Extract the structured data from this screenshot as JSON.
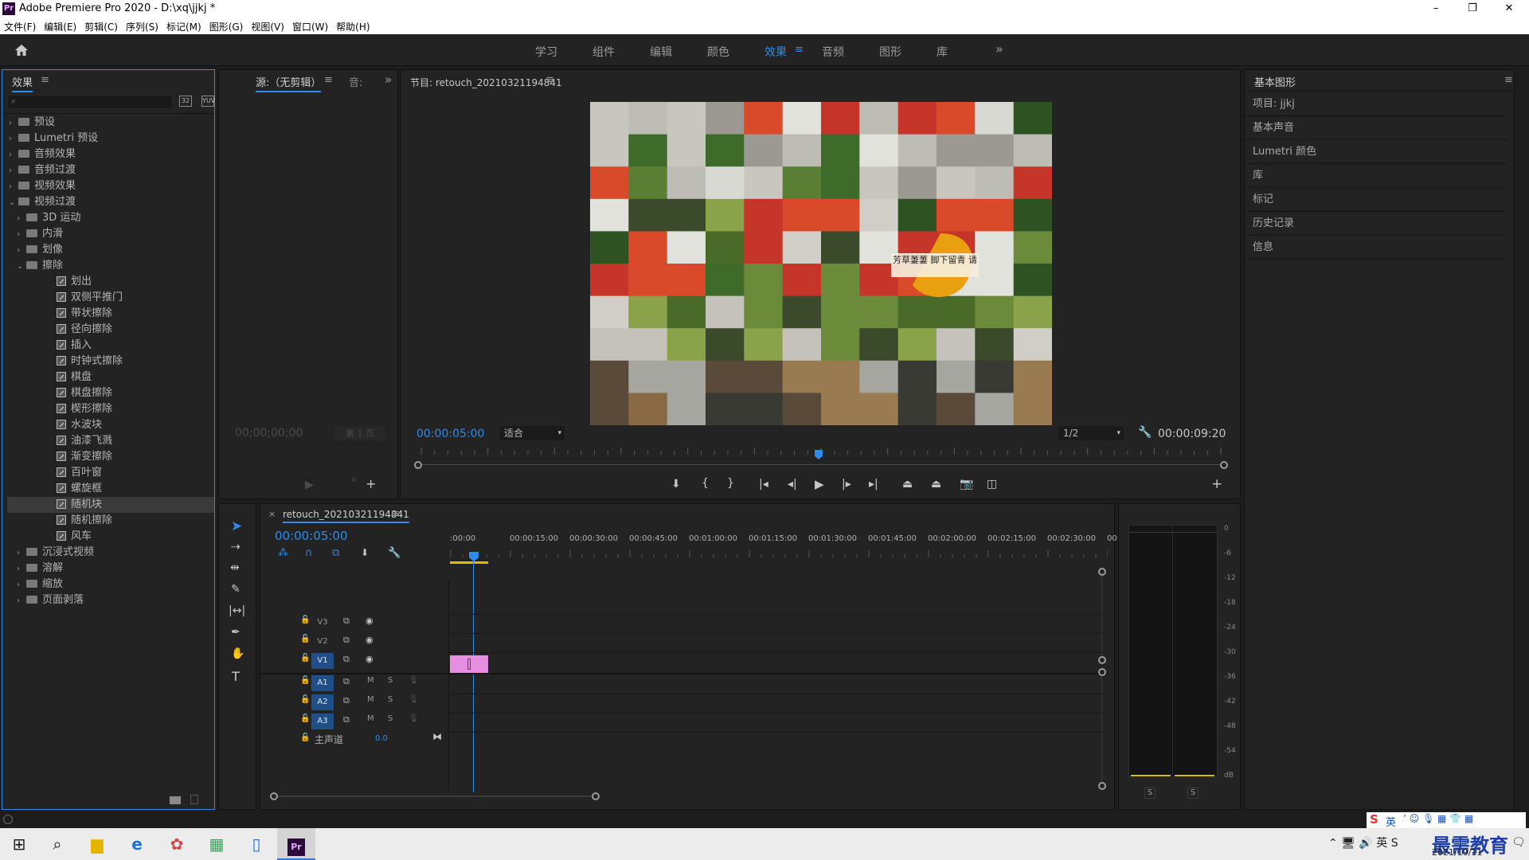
{
  "app": {
    "title": "Adobe Premiere Pro 2020 - D:\\xq\\jjkj *",
    "logo_text": "Pr"
  },
  "window_controls": {
    "minimize": "–",
    "restore": "❐",
    "close": "✕"
  },
  "menu": [
    "文件(F)",
    "编辑(E)",
    "剪辑(C)",
    "序列(S)",
    "标记(M)",
    "图形(G)",
    "视图(V)",
    "窗口(W)",
    "帮助(H)"
  ],
  "workspaces": {
    "tabs": [
      "学习",
      "组件",
      "编辑",
      "颜色",
      "效果",
      "音频",
      "图形",
      "库"
    ],
    "active": "效果",
    "overflow": "»"
  },
  "effects_panel": {
    "title": "效果",
    "tree": [
      {
        "label": "预设",
        "level": 0,
        "kind": "folder",
        "state": "collapsed"
      },
      {
        "label": "Lumetri 预设",
        "level": 0,
        "kind": "folder",
        "state": "collapsed"
      },
      {
        "label": "音频效果",
        "level": 0,
        "kind": "folder",
        "state": "collapsed"
      },
      {
        "label": "音频过渡",
        "level": 0,
        "kind": "folder",
        "state": "collapsed"
      },
      {
        "label": "视频效果",
        "level": 0,
        "kind": "folder",
        "state": "collapsed"
      },
      {
        "label": "视频过渡",
        "level": 0,
        "kind": "folder",
        "state": "expanded"
      },
      {
        "label": "3D 运动",
        "level": 1,
        "kind": "folder",
        "state": "collapsed"
      },
      {
        "label": "内滑",
        "level": 1,
        "kind": "folder",
        "state": "collapsed"
      },
      {
        "label": "划像",
        "level": 1,
        "kind": "folder",
        "state": "collapsed"
      },
      {
        "label": "擦除",
        "level": 1,
        "kind": "folder",
        "state": "expanded"
      },
      {
        "label": "划出",
        "level": 2,
        "kind": "effect"
      },
      {
        "label": "双侧平推门",
        "level": 2,
        "kind": "effect"
      },
      {
        "label": "带状擦除",
        "level": 2,
        "kind": "effect"
      },
      {
        "label": "径向擦除",
        "level": 2,
        "kind": "effect"
      },
      {
        "label": "插入",
        "level": 2,
        "kind": "effect"
      },
      {
        "label": "时钟式擦除",
        "level": 2,
        "kind": "effect"
      },
      {
        "label": "棋盘",
        "level": 2,
        "kind": "effect"
      },
      {
        "label": "棋盘擦除",
        "level": 2,
        "kind": "effect"
      },
      {
        "label": "楔形擦除",
        "level": 2,
        "kind": "effect"
      },
      {
        "label": "水波块",
        "level": 2,
        "kind": "effect"
      },
      {
        "label": "油漆飞溅",
        "level": 2,
        "kind": "effect"
      },
      {
        "label": "渐变擦除",
        "level": 2,
        "kind": "effect"
      },
      {
        "label": "百叶窗",
        "level": 2,
        "kind": "effect"
      },
      {
        "label": "螺旋框",
        "level": 2,
        "kind": "effect"
      },
      {
        "label": "随机块",
        "level": 2,
        "kind": "effect",
        "selected": true
      },
      {
        "label": "随机擦除",
        "level": 2,
        "kind": "effect"
      },
      {
        "label": "风车",
        "level": 2,
        "kind": "effect"
      },
      {
        "label": "沉浸式视频",
        "level": 1,
        "kind": "folder",
        "state": "collapsed"
      },
      {
        "label": "溶解",
        "level": 1,
        "kind": "folder",
        "state": "collapsed"
      },
      {
        "label": "缩放",
        "level": 1,
        "kind": "folder",
        "state": "collapsed"
      },
      {
        "label": "页面剥落",
        "level": 1,
        "kind": "folder",
        "state": "collapsed"
      }
    ]
  },
  "source_panel": {
    "tab1": "源:（无剪辑）",
    "tab2": "音:",
    "timecode": "00;00;00;00",
    "page": "第 1 页"
  },
  "program_monitor": {
    "title": "节目: retouch_20210321194841",
    "timecode": "00:00:05:00",
    "fit": "适合",
    "resolution": "1/2",
    "duration": "00:00:09:20",
    "overlay_text": "芳草萋萋 脚下留青 请",
    "playhead_progress": 0.5
  },
  "right_panel": {
    "title": "基本图形",
    "items": [
      "项目: jjkj",
      "基本声音",
      "Lumetri 颜色",
      "库",
      "标记",
      "历史记录",
      "信息"
    ]
  },
  "timeline": {
    "title": "retouch_20210321194841",
    "timecode": "00:00:05:00",
    "ruler": [
      ":00:00",
      "00:00:15:00",
      "00:00:30:00",
      "00:00:45:00",
      "00:01:00:00",
      "00:01:15:00",
      "00:01:30:00",
      "00:01:45:00",
      "00:02:00:00",
      "00:02:15:00",
      "00:02:30:00",
      "00:"
    ],
    "video_tracks": [
      "V3",
      "V2",
      "V1"
    ],
    "audio_tracks": [
      "A1",
      "A2",
      "A3"
    ],
    "master": {
      "label": "主声道",
      "value": "0.0"
    },
    "mute": "M",
    "solo": "S",
    "clip_color": "#e58fe0"
  },
  "audio_meter": {
    "scale": [
      "0",
      "-6",
      "-12",
      "-18",
      "-24",
      "-30",
      "-36",
      "-42",
      "-48",
      "-54",
      "dB"
    ],
    "solo_labels": [
      "S",
      "S"
    ]
  },
  "taskbar": {
    "ime": "英",
    "watermark": "最需教育",
    "date": "2021/10/11"
  },
  "colors": {
    "accent": "#2d8ceb",
    "panel": "#232323",
    "border": "#111111"
  }
}
